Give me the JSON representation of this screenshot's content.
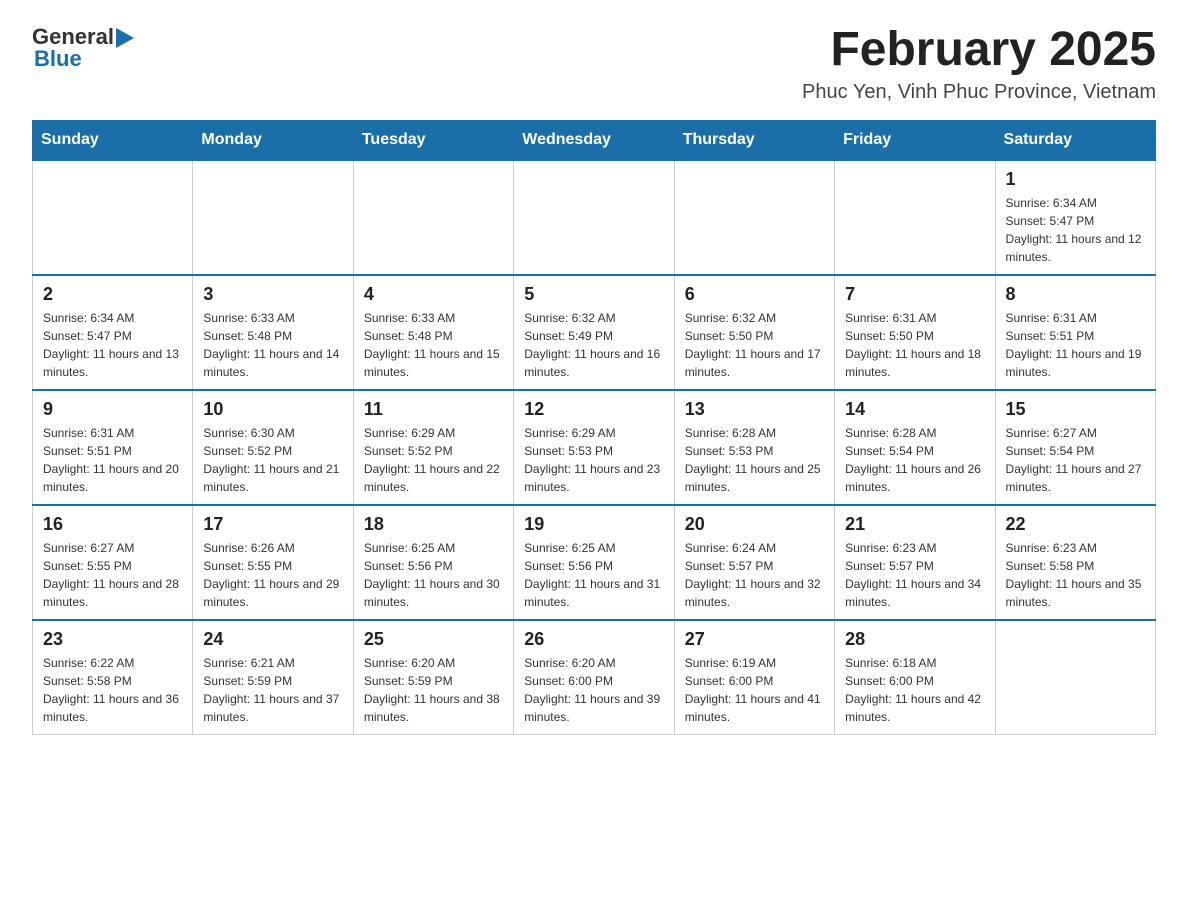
{
  "header": {
    "logo_general": "General",
    "logo_blue": "Blue",
    "month_title": "February 2025",
    "location": "Phuc Yen, Vinh Phuc Province, Vietnam"
  },
  "weekdays": [
    "Sunday",
    "Monday",
    "Tuesday",
    "Wednesday",
    "Thursday",
    "Friday",
    "Saturday"
  ],
  "weeks": [
    [
      {
        "day": "",
        "info": ""
      },
      {
        "day": "",
        "info": ""
      },
      {
        "day": "",
        "info": ""
      },
      {
        "day": "",
        "info": ""
      },
      {
        "day": "",
        "info": ""
      },
      {
        "day": "",
        "info": ""
      },
      {
        "day": "1",
        "info": "Sunrise: 6:34 AM\nSunset: 5:47 PM\nDaylight: 11 hours and 12 minutes."
      }
    ],
    [
      {
        "day": "2",
        "info": "Sunrise: 6:34 AM\nSunset: 5:47 PM\nDaylight: 11 hours and 13 minutes."
      },
      {
        "day": "3",
        "info": "Sunrise: 6:33 AM\nSunset: 5:48 PM\nDaylight: 11 hours and 14 minutes."
      },
      {
        "day": "4",
        "info": "Sunrise: 6:33 AM\nSunset: 5:48 PM\nDaylight: 11 hours and 15 minutes."
      },
      {
        "day": "5",
        "info": "Sunrise: 6:32 AM\nSunset: 5:49 PM\nDaylight: 11 hours and 16 minutes."
      },
      {
        "day": "6",
        "info": "Sunrise: 6:32 AM\nSunset: 5:50 PM\nDaylight: 11 hours and 17 minutes."
      },
      {
        "day": "7",
        "info": "Sunrise: 6:31 AM\nSunset: 5:50 PM\nDaylight: 11 hours and 18 minutes."
      },
      {
        "day": "8",
        "info": "Sunrise: 6:31 AM\nSunset: 5:51 PM\nDaylight: 11 hours and 19 minutes."
      }
    ],
    [
      {
        "day": "9",
        "info": "Sunrise: 6:31 AM\nSunset: 5:51 PM\nDaylight: 11 hours and 20 minutes."
      },
      {
        "day": "10",
        "info": "Sunrise: 6:30 AM\nSunset: 5:52 PM\nDaylight: 11 hours and 21 minutes."
      },
      {
        "day": "11",
        "info": "Sunrise: 6:29 AM\nSunset: 5:52 PM\nDaylight: 11 hours and 22 minutes."
      },
      {
        "day": "12",
        "info": "Sunrise: 6:29 AM\nSunset: 5:53 PM\nDaylight: 11 hours and 23 minutes."
      },
      {
        "day": "13",
        "info": "Sunrise: 6:28 AM\nSunset: 5:53 PM\nDaylight: 11 hours and 25 minutes."
      },
      {
        "day": "14",
        "info": "Sunrise: 6:28 AM\nSunset: 5:54 PM\nDaylight: 11 hours and 26 minutes."
      },
      {
        "day": "15",
        "info": "Sunrise: 6:27 AM\nSunset: 5:54 PM\nDaylight: 11 hours and 27 minutes."
      }
    ],
    [
      {
        "day": "16",
        "info": "Sunrise: 6:27 AM\nSunset: 5:55 PM\nDaylight: 11 hours and 28 minutes."
      },
      {
        "day": "17",
        "info": "Sunrise: 6:26 AM\nSunset: 5:55 PM\nDaylight: 11 hours and 29 minutes."
      },
      {
        "day": "18",
        "info": "Sunrise: 6:25 AM\nSunset: 5:56 PM\nDaylight: 11 hours and 30 minutes."
      },
      {
        "day": "19",
        "info": "Sunrise: 6:25 AM\nSunset: 5:56 PM\nDaylight: 11 hours and 31 minutes."
      },
      {
        "day": "20",
        "info": "Sunrise: 6:24 AM\nSunset: 5:57 PM\nDaylight: 11 hours and 32 minutes."
      },
      {
        "day": "21",
        "info": "Sunrise: 6:23 AM\nSunset: 5:57 PM\nDaylight: 11 hours and 34 minutes."
      },
      {
        "day": "22",
        "info": "Sunrise: 6:23 AM\nSunset: 5:58 PM\nDaylight: 11 hours and 35 minutes."
      }
    ],
    [
      {
        "day": "23",
        "info": "Sunrise: 6:22 AM\nSunset: 5:58 PM\nDaylight: 11 hours and 36 minutes."
      },
      {
        "day": "24",
        "info": "Sunrise: 6:21 AM\nSunset: 5:59 PM\nDaylight: 11 hours and 37 minutes."
      },
      {
        "day": "25",
        "info": "Sunrise: 6:20 AM\nSunset: 5:59 PM\nDaylight: 11 hours and 38 minutes."
      },
      {
        "day": "26",
        "info": "Sunrise: 6:20 AM\nSunset: 6:00 PM\nDaylight: 11 hours and 39 minutes."
      },
      {
        "day": "27",
        "info": "Sunrise: 6:19 AM\nSunset: 6:00 PM\nDaylight: 11 hours and 41 minutes."
      },
      {
        "day": "28",
        "info": "Sunrise: 6:18 AM\nSunset: 6:00 PM\nDaylight: 11 hours and 42 minutes."
      },
      {
        "day": "",
        "info": ""
      }
    ]
  ]
}
